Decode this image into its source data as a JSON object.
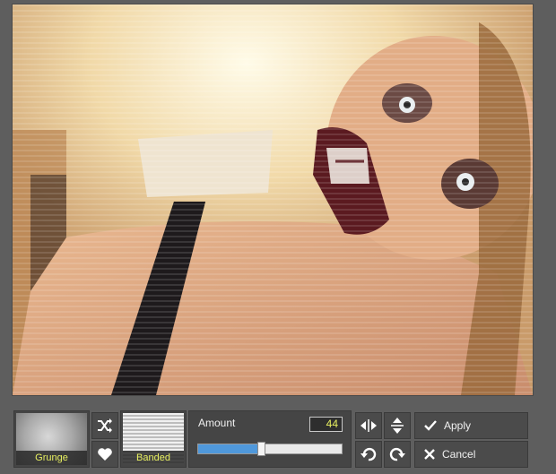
{
  "filters": {
    "grunge": {
      "label": "Grunge"
    },
    "banded": {
      "label": "Banded"
    }
  },
  "adjust": {
    "amount_label": "Amount",
    "amount_value": "44",
    "amount_fraction": 0.44
  },
  "actions": {
    "apply_label": "Apply",
    "cancel_label": "Cancel"
  },
  "icons": {
    "shuffle": "shuffle-icon",
    "favorite": "heart-icon",
    "flip_h": "flip-horizontal-icon",
    "flip_v": "flip-vertical-icon",
    "rotate_left": "rotate-left-icon",
    "rotate_right": "rotate-right-icon",
    "apply": "check-icon",
    "cancel": "close-icon"
  },
  "colors": {
    "accent": "#4f98db",
    "label_highlight": "#e8f060",
    "panel": "#454545"
  }
}
